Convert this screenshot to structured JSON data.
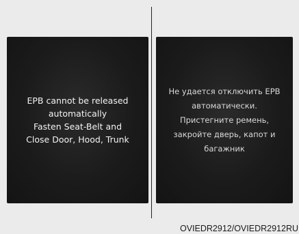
{
  "screens": {
    "english": {
      "lines": [
        "EPB cannot be released",
        "automatically",
        "Fasten Seat-Belt and",
        "Close Door, Hood, Trunk"
      ]
    },
    "russian": {
      "lines": [
        "Не удается отключить EPB",
        "автоматически.",
        "Пристегните ремень,",
        "закройте дверь, капот и",
        "багажник"
      ]
    }
  },
  "caption": "OVIEDR2912/OVIEDR2912RU"
}
